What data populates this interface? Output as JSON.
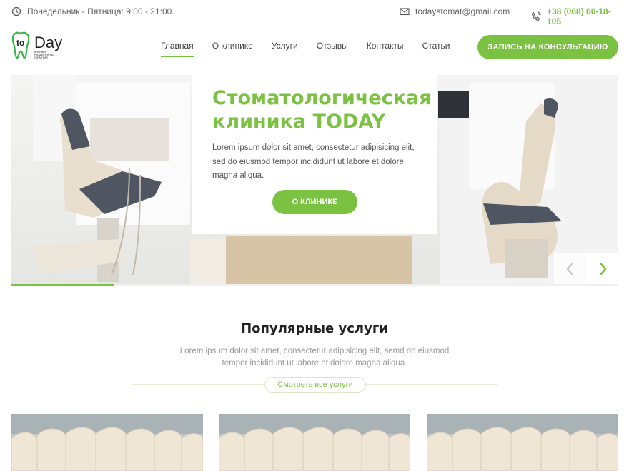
{
  "topbar": {
    "hours": "Понедельник - Пятница: 9:00 - 21:00.",
    "email": "todaystomat@gmail.com",
    "phone": "+38 (068) 60-18-105"
  },
  "logo": {
    "name": "toDay",
    "tagline": "КЛИНИКА РАСШИРЕННЫХ ГАРАНТИЙ"
  },
  "nav": [
    {
      "label": "Главная",
      "active": true
    },
    {
      "label": "О клинике"
    },
    {
      "label": "Услуги"
    },
    {
      "label": "Отзывы"
    },
    {
      "label": "Контакты"
    },
    {
      "label": "Статьи"
    }
  ],
  "cta_label": "ЗАПИСЬ НА КОНСУЛЬТАЦИЮ",
  "hero": {
    "title": "Стоматологическая клиника TODAY",
    "text": "Lorem ipsum dolor sit amet, consectetur adipisicing elit, sed do eiusmod tempor incididunt ut labore et dolore magna aliqua.",
    "button_label": "О КЛИНИКЕ",
    "progress": 0.17
  },
  "services": {
    "title": "Популярные услуги",
    "text": "Lorem ipsum dolor sit amet, consectetur adipisicing elit, semd do eiusmod tempor incididunt ut labore et dolore magna aliqua.",
    "link_label": "Смотреть все услуги"
  },
  "colors": {
    "accent": "#7cc242",
    "text": "#444444",
    "muted": "#999999"
  },
  "icons": [
    "clock-icon",
    "mail-icon",
    "phone-icon",
    "chevron-left-icon",
    "chevron-right-icon"
  ]
}
